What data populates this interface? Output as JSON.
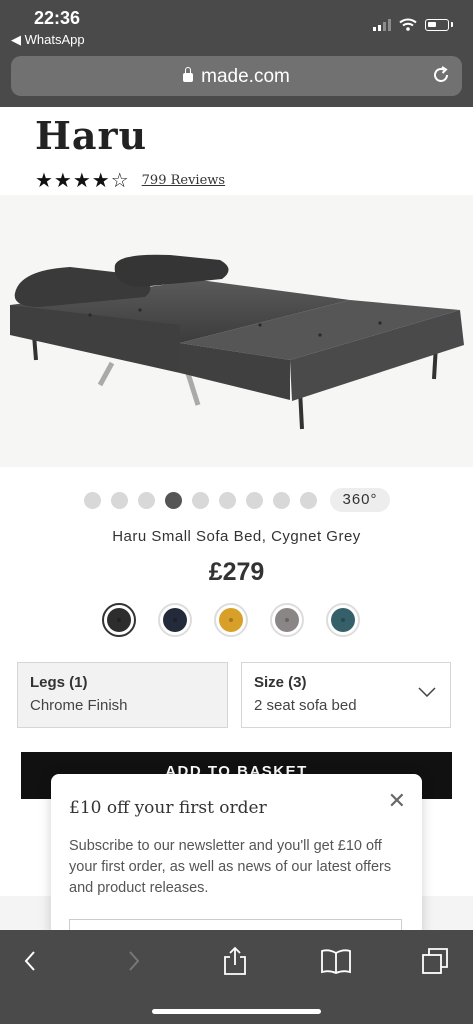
{
  "status_bar": {
    "time": "22:36",
    "back_app": "◀ WhatsApp"
  },
  "browser": {
    "url": "made.com"
  },
  "product": {
    "title": "Haru",
    "rating": 4.5,
    "stars_text": "★★★★☆",
    "reviews": "799 Reviews",
    "name": "Haru Small Sofa Bed, Cygnet Grey",
    "price": "£279",
    "view_360": "360°"
  },
  "carousel": {
    "count": 9,
    "active_index": 3
  },
  "swatches": [
    {
      "name": "charcoal-swatch",
      "color": "#2d2d2d",
      "selected": true
    },
    {
      "name": "navy-swatch",
      "color": "#232a3a",
      "selected": false
    },
    {
      "name": "mustard-swatch",
      "color": "#d9a029",
      "selected": false
    },
    {
      "name": "grey-swatch",
      "color": "#8a8685",
      "selected": false
    },
    {
      "name": "teal-swatch",
      "color": "#35606a",
      "selected": false
    }
  ],
  "options": {
    "legs": {
      "label": "Legs (1)",
      "value": "Chrome Finish"
    },
    "size": {
      "label": "Size (3)",
      "value": "2 seat sofa bed"
    }
  },
  "basket_label": "ADD TO BASKET",
  "popup": {
    "title": "£10 off your first order",
    "body": "Subscribe to our newsletter and you'll get £10 off your first order, as well as news of our latest offers and product releases."
  },
  "colors": {
    "chrome": "#4a4a4a",
    "basket": "#111111"
  }
}
